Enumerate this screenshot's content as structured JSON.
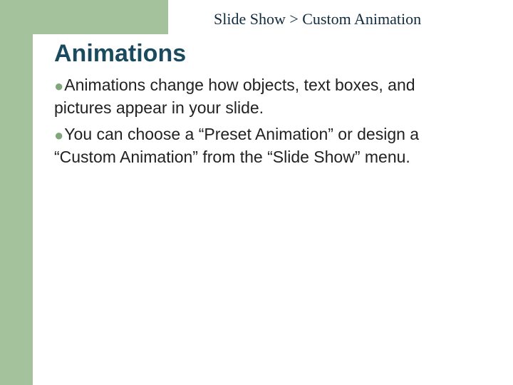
{
  "breadcrumb": "Slide Show > Custom Animation",
  "title": "Animations",
  "bullets": [
    "Animations change how objects, text boxes, and pictures appear in your slide.",
    "You can choose a “Preset Animation” or design a “Custom Animation” from the “Slide Show” menu."
  ]
}
